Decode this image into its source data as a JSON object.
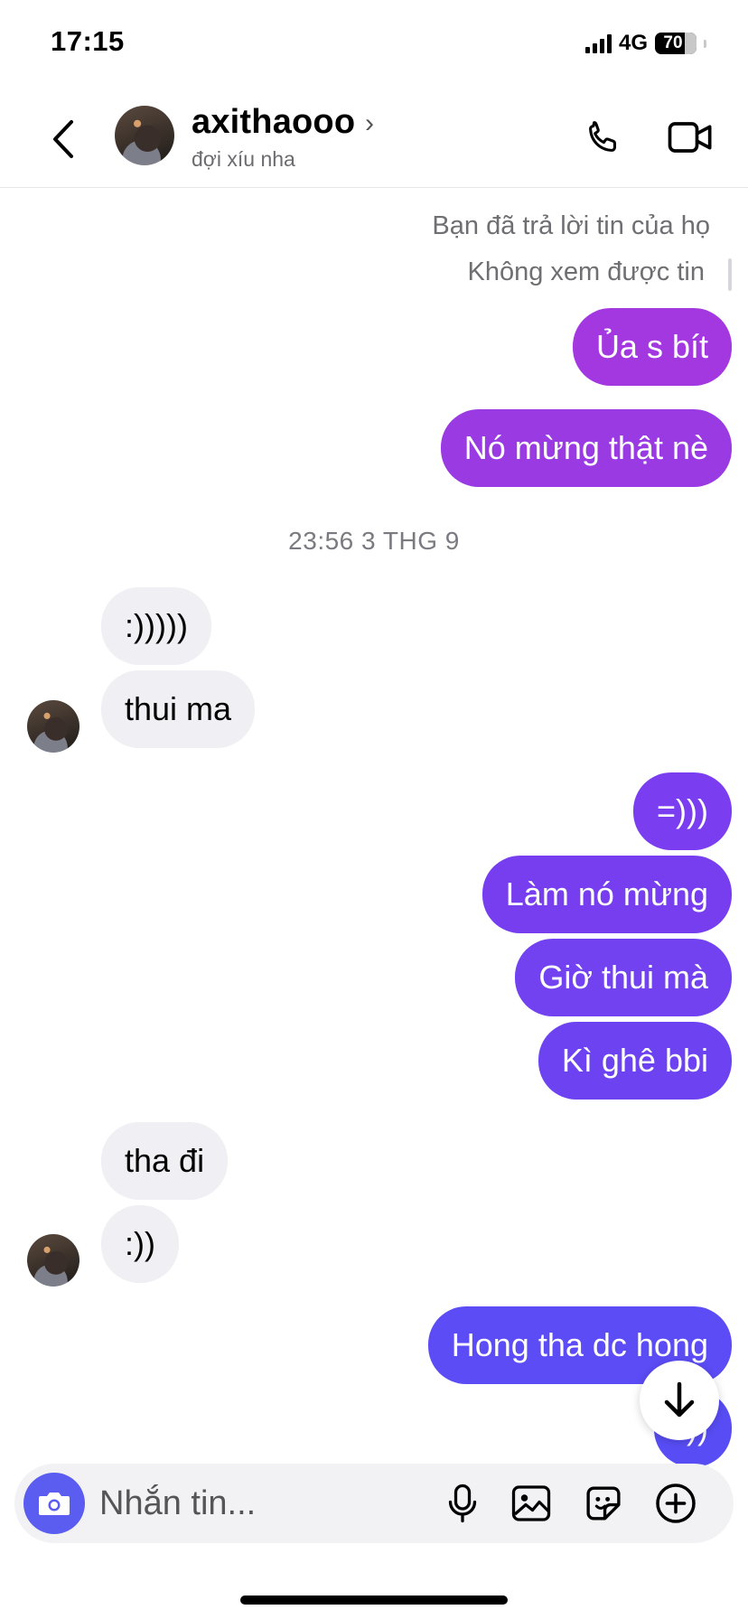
{
  "status_bar": {
    "time": "17:15",
    "network": "4G",
    "battery": "70"
  },
  "header": {
    "name": "axithaooo",
    "chevron": "›",
    "status": "đợi xíu nha"
  },
  "reply": {
    "note": "Bạn đã trả lời tin của họ",
    "quoted": "Không xem được tin"
  },
  "messages_top": [
    {
      "text": "Ủa s bít",
      "from": "me"
    },
    {
      "text": "Nó mừng thật nè",
      "from": "me"
    }
  ],
  "timestamp": "23:56 3 THG 9",
  "messages": {
    "in1": ":)))))",
    "in2": "thui ma",
    "out1": "=)))",
    "out2": "Làm nó mừng",
    "out3": "Giờ thui mà",
    "out4": "Kì ghê bbi",
    "in3": "tha đi",
    "in4": ":))",
    "out5": "Hong tha dc hong",
    "out6": ":))"
  },
  "composer": {
    "placeholder": "Nhắn tin..."
  },
  "icons": {
    "back": "chevron-left-icon",
    "call": "phone-icon",
    "video": "video-camera-icon",
    "scroll": "arrow-down-icon",
    "camera": "camera-icon",
    "mic": "microphone-icon",
    "gallery": "image-icon",
    "sticker": "sticker-icon",
    "plus": "plus-circle-icon"
  },
  "colors": {
    "bubble_out_top": "#a338e0",
    "bubble_out_mid": "#7a3ef0",
    "bubble_out_bottom": "#5b4cf5",
    "bubble_in": "#efeff4",
    "camera_button": "#5b5cf0"
  }
}
